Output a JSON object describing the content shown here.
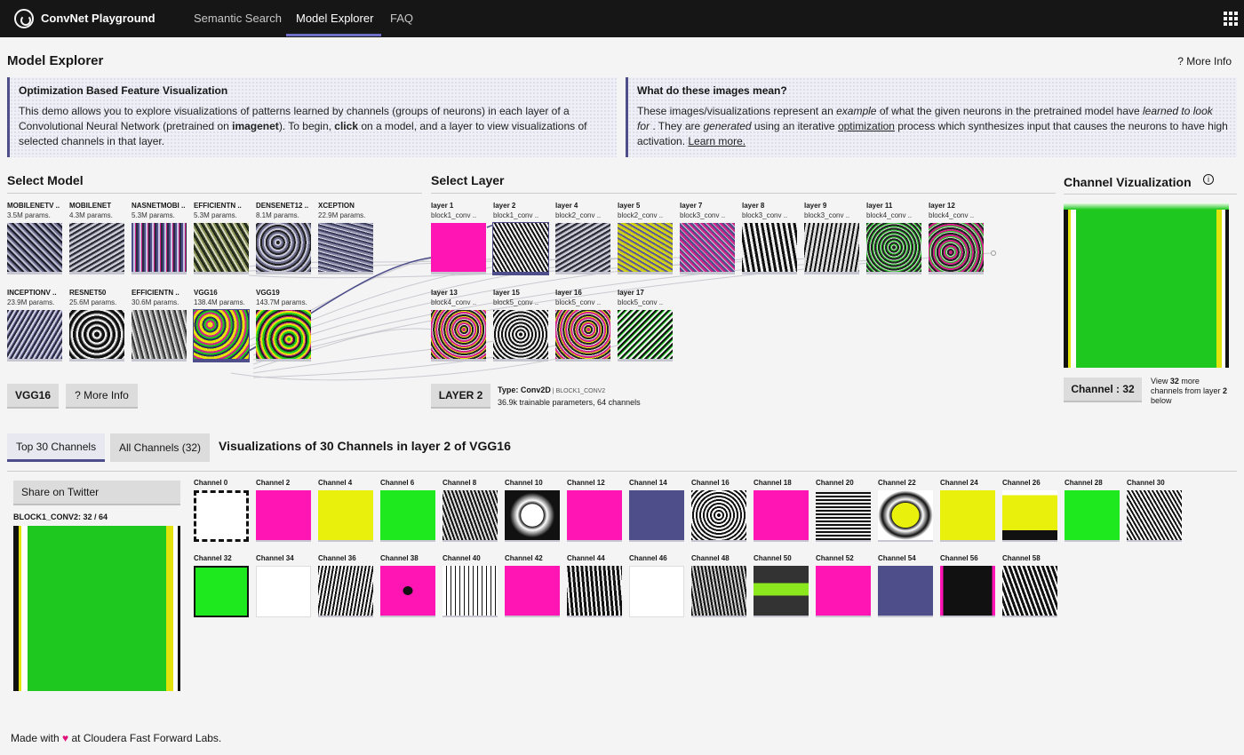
{
  "header": {
    "app_title": "ConvNet Playground",
    "nav": [
      "Semantic Search",
      "Model Explorer",
      "FAQ"
    ],
    "active_nav": "Model Explorer"
  },
  "page": {
    "title": "Model Explorer",
    "more_info": "? More Info"
  },
  "left_panel": {
    "heading": "Optimization Based Feature Visualization",
    "t1": "This demo allows you to explore visualizations of patterns learned by channels (groups of neurons) in each layer of a Convolutional Neural Network (pretrained on ",
    "t2": "imagenet",
    "t3": "). To begin, ",
    "t4": "click",
    "t5": " on a model, and a layer to view visualizations of selected channels in that layer."
  },
  "right_panel": {
    "heading": "What do these images mean?",
    "t1": "These images/visualizations represent an ",
    "t2": "example",
    "t3": " of what the given neurons in the pretrained model have ",
    "t4": "learned to look for",
    "t5": " . They are ",
    "t6": "generated",
    "t7": " using an iterative ",
    "t8": "optimization",
    "t9": " process which synthesizes input that causes the neurons to have high activation. ",
    "t10": "Learn more."
  },
  "select_model": {
    "title": "Select Model",
    "models": [
      {
        "name": "MOBILENETV ..",
        "params": "3.5M params."
      },
      {
        "name": "MOBILENET",
        "params": "4.3M params."
      },
      {
        "name": "NASNETMOBI ..",
        "params": "5.3M params."
      },
      {
        "name": "EFFICIENTN ..",
        "params": "5.3M params."
      },
      {
        "name": "DENSENET12 ..",
        "params": "8.1M params."
      },
      {
        "name": "XCEPTION",
        "params": "22.9M params."
      },
      {
        "name": "INCEPTIONV ..",
        "params": "23.9M params."
      },
      {
        "name": "RESNET50",
        "params": "25.6M params."
      },
      {
        "name": "EFFICIENTN ..",
        "params": "30.6M params."
      },
      {
        "name": "VGG16",
        "params": "138.4M params."
      },
      {
        "name": "VGG19",
        "params": "143.7M params."
      }
    ],
    "selected_button": "VGG16",
    "more_info_button": "? More Info"
  },
  "select_layer": {
    "title": "Select Layer",
    "layers": [
      {
        "name": "layer 1",
        "sub": "block1_conv .."
      },
      {
        "name": "layer 2",
        "sub": "block1_conv .."
      },
      {
        "name": "layer 4",
        "sub": "block2_conv .."
      },
      {
        "name": "layer 5",
        "sub": "block2_conv .."
      },
      {
        "name": "layer 7",
        "sub": "block3_conv .."
      },
      {
        "name": "layer 8",
        "sub": "block3_conv .."
      },
      {
        "name": "layer 9",
        "sub": "block3_conv .."
      },
      {
        "name": "layer 11",
        "sub": "block4_conv .."
      },
      {
        "name": "layer 12",
        "sub": "block4_conv .."
      },
      {
        "name": "layer 13",
        "sub": "block4_conv .."
      },
      {
        "name": "layer 15",
        "sub": "block5_conv .."
      },
      {
        "name": "layer 16",
        "sub": "block5_conv .."
      },
      {
        "name": "layer 17",
        "sub": "block5_conv .."
      }
    ],
    "selected_button": "LAYER 2",
    "type_label": "Type: Conv2D",
    "type_sep": " | ",
    "type_name": "BLOCK1_CONV2",
    "params_line": "36.9k trainable parameters, 64 channels"
  },
  "channel_viz": {
    "title": "Channel Vizualization",
    "info_icon": "i",
    "channel_button": "Channel : 32",
    "note_1": "View ",
    "note_2": "32",
    "note_3": " more channels from layer ",
    "note_4": "2",
    "note_5": " below",
    "color": "#1ec81e"
  },
  "tabs": [
    "Top 30 Channels",
    "All Channels (32)"
  ],
  "viz_title": "Visualizations of 30 Channels in layer 2 of VGG16",
  "share": {
    "button": "Share on Twitter",
    "label": "BLOCK1_CONV2: 32 / 64"
  },
  "channels": [
    {
      "name": "Channel 0"
    },
    {
      "name": "Channel 2"
    },
    {
      "name": "Channel 4"
    },
    {
      "name": "Channel 6"
    },
    {
      "name": "Channel 8"
    },
    {
      "name": "Channel 10"
    },
    {
      "name": "Channel 12"
    },
    {
      "name": "Channel 14"
    },
    {
      "name": "Channel 16"
    },
    {
      "name": "Channel 18"
    },
    {
      "name": "Channel 20"
    },
    {
      "name": "Channel 22"
    },
    {
      "name": "Channel 24"
    },
    {
      "name": "Channel 26"
    },
    {
      "name": "Channel 28"
    },
    {
      "name": "Channel 30"
    },
    {
      "name": "Channel 32"
    },
    {
      "name": "Channel 34"
    },
    {
      "name": "Channel 36"
    },
    {
      "name": "Channel 38"
    },
    {
      "name": "Channel 40"
    },
    {
      "name": "Channel 42"
    },
    {
      "name": "Channel 44"
    },
    {
      "name": "Channel 46"
    },
    {
      "name": "Channel 48"
    },
    {
      "name": "Channel 50"
    },
    {
      "name": "Channel 52"
    },
    {
      "name": "Channel 54"
    },
    {
      "name": "Channel 56"
    },
    {
      "name": "Channel 58"
    }
  ],
  "footer": {
    "t1": "Made with ",
    "heart": "♥",
    "t2": " at ",
    "t3": "Cloudera Fast Forward Labs."
  },
  "colors": {
    "accent": "#4e4e8a",
    "magenta": "#e0109a",
    "green": "#1ec81e",
    "yellow": "#e2e20c",
    "topbar": "#161616"
  }
}
